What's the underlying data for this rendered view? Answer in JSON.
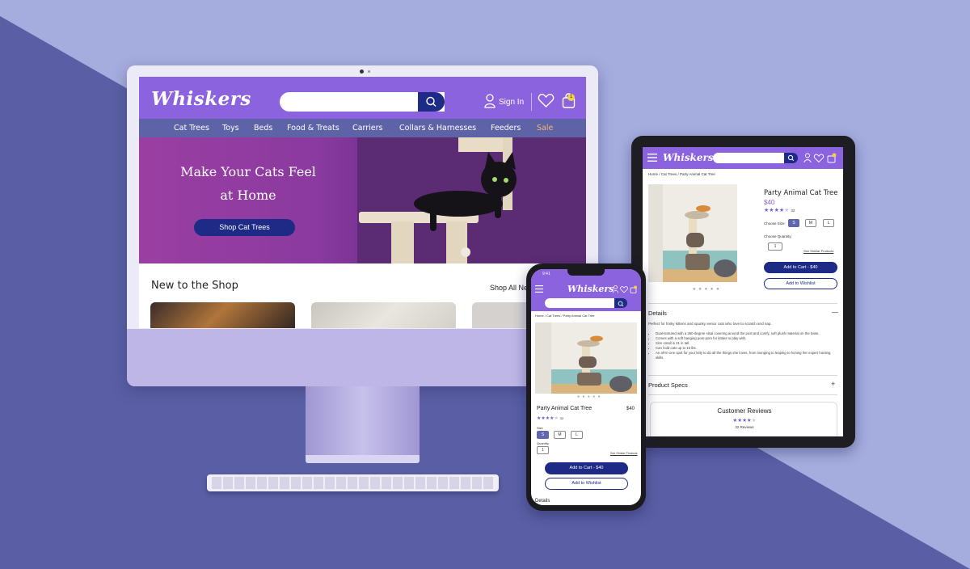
{
  "brand": {
    "name": "Whiskers",
    "primary_color": "#8b63de",
    "navy": "#1d2a86",
    "nav_color": "#5e62a7",
    "sale_color": "#f4b76c"
  },
  "desktop": {
    "sign_in": "Sign In",
    "cart_count": "1",
    "nav": [
      "Cat Trees",
      "Toys",
      "Beds",
      "Food & Treats",
      "Carriers",
      "Collars & Harnesses",
      "Feeders",
      "Sale"
    ],
    "hero": {
      "line1": "Make Your Cats Feel",
      "line2": "at Home",
      "cta": "Shop Cat Trees"
    },
    "section_title": "New to the Shop",
    "shop_all": "Shop All New"
  },
  "product": {
    "breadcrumb": "Home / Cat Trees / Party Animal Cat Tree",
    "title": "Party Animal Cat Tree",
    "price": "$40",
    "stars": "★★★★★",
    "rating_count": "32",
    "rating_value": 4,
    "rating_max": 5,
    "size_label_tablet": "Choose Size:",
    "size_label_phone": "Size",
    "sizes": [
      "S",
      "M",
      "L"
    ],
    "selected_size": "S",
    "qty_label_tablet": "Choose Quantity:",
    "qty_label_phone": "Quantity",
    "qty_value": "1",
    "similar": "See Similar Products",
    "add_to_cart": "Add to Cart - $40",
    "wishlist": "Add to Wishlist",
    "details_title": "Details",
    "details_intro": "Perfect for frisky kittens and spunky senior cats who love to scratch and nap.",
    "details_bullets": [
      "Dual-textured with a 360-degree sisal covering around the post and comfy, soft plush material on the base.",
      "Comes with a soft hanging pom-pom for kitties to play with.",
      "Size small is 21 in tall.",
      "Can hold cats up to 15 lbs.",
      "An all-in-one spot for your kitty to do all the things she loves, from lounging to leaping to honing her expert hunting skills."
    ],
    "specs_title": "Product Specs",
    "reviews_title": "Customer Reviews",
    "reviews_count": "32 Reviews"
  },
  "phone": {
    "time": "9:41"
  }
}
